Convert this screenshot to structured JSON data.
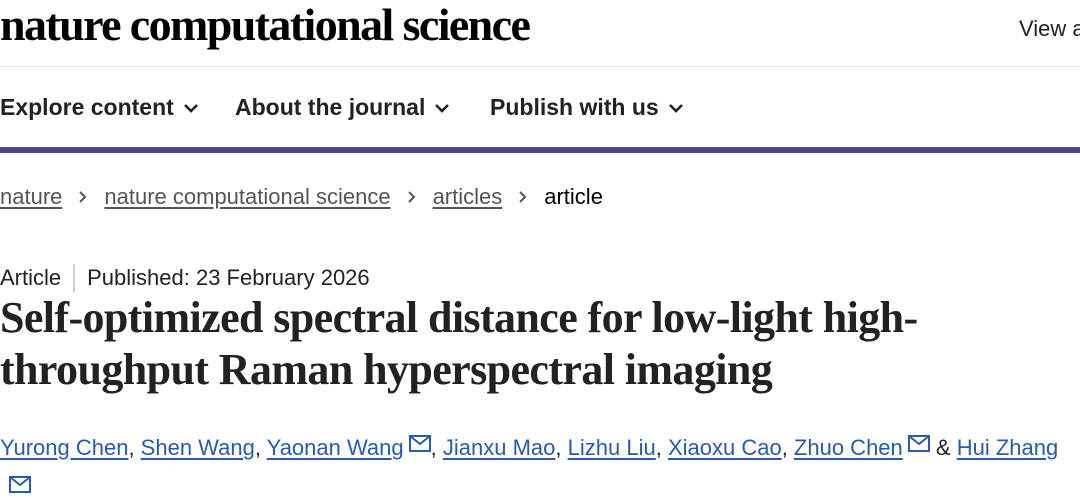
{
  "header": {
    "brand": "nature computational science",
    "view_link": "View a"
  },
  "nav": {
    "items": [
      {
        "label": "Explore content"
      },
      {
        "label": "About the journal"
      },
      {
        "label": "Publish with us"
      }
    ]
  },
  "breadcrumb": {
    "items": [
      "nature",
      "nature computational science",
      "articles"
    ],
    "current": "article"
  },
  "article": {
    "type": "Article",
    "published": "Published: 23 February 2026",
    "title_line1": "Self-optimized spectral distance for low-light high-",
    "title_line2": "throughput Raman hyperspectral imaging"
  },
  "authors": {
    "names": [
      "Yurong Chen",
      "Shen Wang",
      "Yaonan Wang",
      "Jianxu Mao",
      "Lizhu Liu",
      "Xiaoxu Cao",
      "Zhuo Chen",
      "Hui Zhang"
    ],
    "separator": ", ",
    "conjunction": "&"
  },
  "colors": {
    "nav_rule": "#4a4a86",
    "link": "#2a5aa8",
    "text": "#222222"
  },
  "icons": [
    "chevron-down-icon",
    "chevron-right-icon",
    "mail-icon"
  ]
}
